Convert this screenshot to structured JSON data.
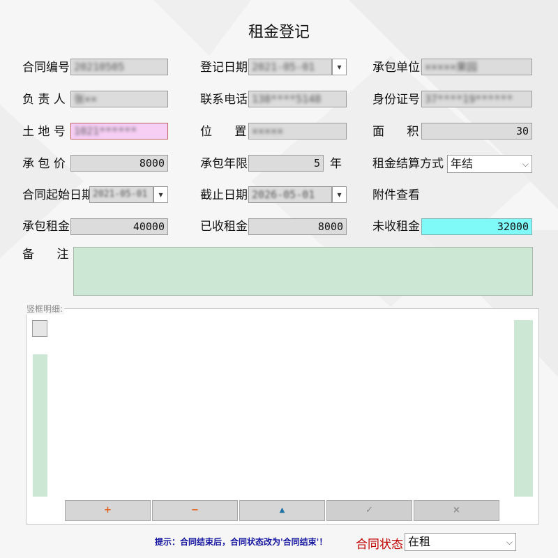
{
  "window": {
    "title": "租金登记"
  },
  "form": {
    "contract_no": {
      "label": "合同编号",
      "value": "20210505"
    },
    "reg_date": {
      "label": "登记日期",
      "value": "2021-05-01"
    },
    "contractor": {
      "label": "承包单位",
      "value": "×××××果园"
    },
    "person": {
      "label": "负 责 人",
      "value": "张××"
    },
    "phone": {
      "label": "联系电话",
      "value": "138****5148"
    },
    "idcard": {
      "label": "身份证号",
      "value": "37****19******"
    },
    "land_no": {
      "label": "土 地 号",
      "value": "1021******"
    },
    "location": {
      "label": "位      置",
      "value": "×××××"
    },
    "area": {
      "label": "面      积",
      "value": "30"
    },
    "price": {
      "label": "承 包 价",
      "value": "8000"
    },
    "years": {
      "label": "承包年限",
      "value": "5",
      "unit": "年"
    },
    "settle": {
      "label": "租金结算方式",
      "value": "年结"
    },
    "start_date": {
      "label": "合同起始日期",
      "value": "2021-05-01"
    },
    "end_date": {
      "label": "截止日期",
      "value": "2026-05-01"
    },
    "attach": {
      "label": "附件查看"
    },
    "rent_total": {
      "label": "承包租金",
      "value": "40000"
    },
    "rent_received": {
      "label": "已收租金",
      "value": "8000"
    },
    "rent_unpaid": {
      "label": "未收租金",
      "value": "32000"
    },
    "remark": {
      "label": "备      注",
      "value": ""
    }
  },
  "detail": {
    "group_label": "竖框明细:",
    "buttons": {
      "add": "+",
      "remove": "−",
      "up": "▲",
      "ok": "✓",
      "cancel": "×"
    }
  },
  "footer": {
    "hint": "提示：合同结束后，合同状态改为'合同结束'！",
    "status_label": "合同状态",
    "status_value": "在租"
  },
  "colors": {
    "unpaid_bg": "#7ffaf9",
    "land_bg": "#f7cff5",
    "memo_bg": "#cce8d4",
    "status_label": "#c00000",
    "hint": "#1414a0"
  },
  "icons": {
    "dropdown": "chevron-down-icon",
    "spin": "spin-arrows-icon"
  }
}
